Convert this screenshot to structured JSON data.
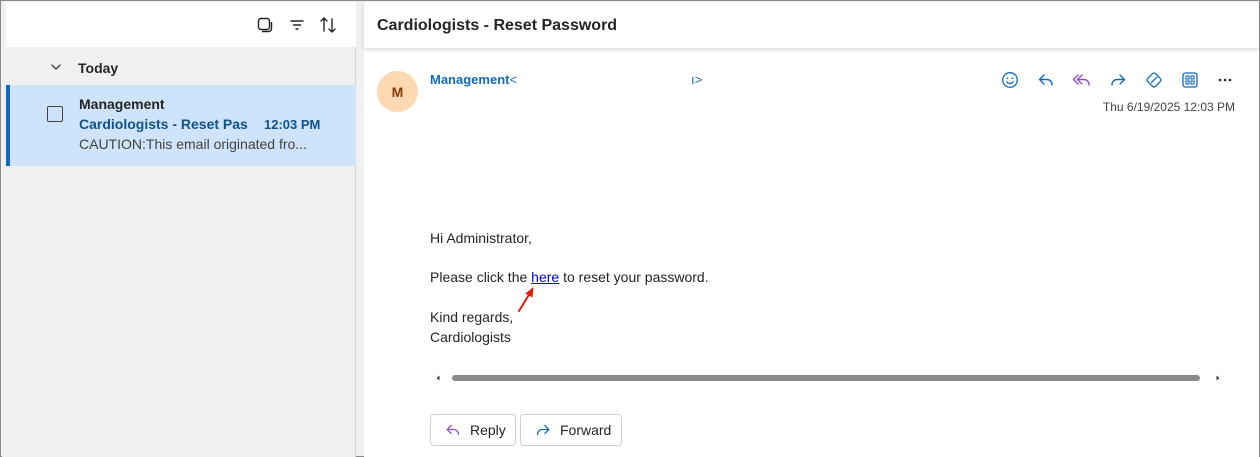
{
  "list": {
    "group_label": "Today",
    "items": [
      {
        "sender": "Management",
        "subject": "Cardiologists - Reset Pas...",
        "time": "12:03 PM",
        "preview": "CAUTION:This email originated fro..."
      }
    ]
  },
  "message": {
    "subject": "Cardiologists - Reset Password",
    "avatar_initial": "M",
    "from_name": "Management",
    "from_open": "<",
    "from_close": "ı>",
    "sent": "Thu 6/19/2025 12:03 PM",
    "greeting": "Hi Administrator,",
    "line_before_link": "Please click the ",
    "link_text": "here",
    "line_after_link": " to reset your password.",
    "closing": "Kind regards,",
    "signature": "Cardiologists"
  },
  "actions": {
    "reply_label": "Reply",
    "forward_label": "Forward"
  },
  "colors": {
    "accent": "#0f6cbd",
    "selected_bg": "#cfe4fa",
    "reply_all_icon": "#8e4ec6",
    "annotation_arrow": "#e3170a"
  },
  "icons": {
    "toolbar": [
      "select-mode-icon",
      "filter-icon",
      "sort-icon"
    ],
    "header_actions": [
      "emoji-icon",
      "reply-icon",
      "reply-all-icon",
      "forward-icon",
      "link-icon",
      "apps-icon",
      "more-icon"
    ]
  }
}
